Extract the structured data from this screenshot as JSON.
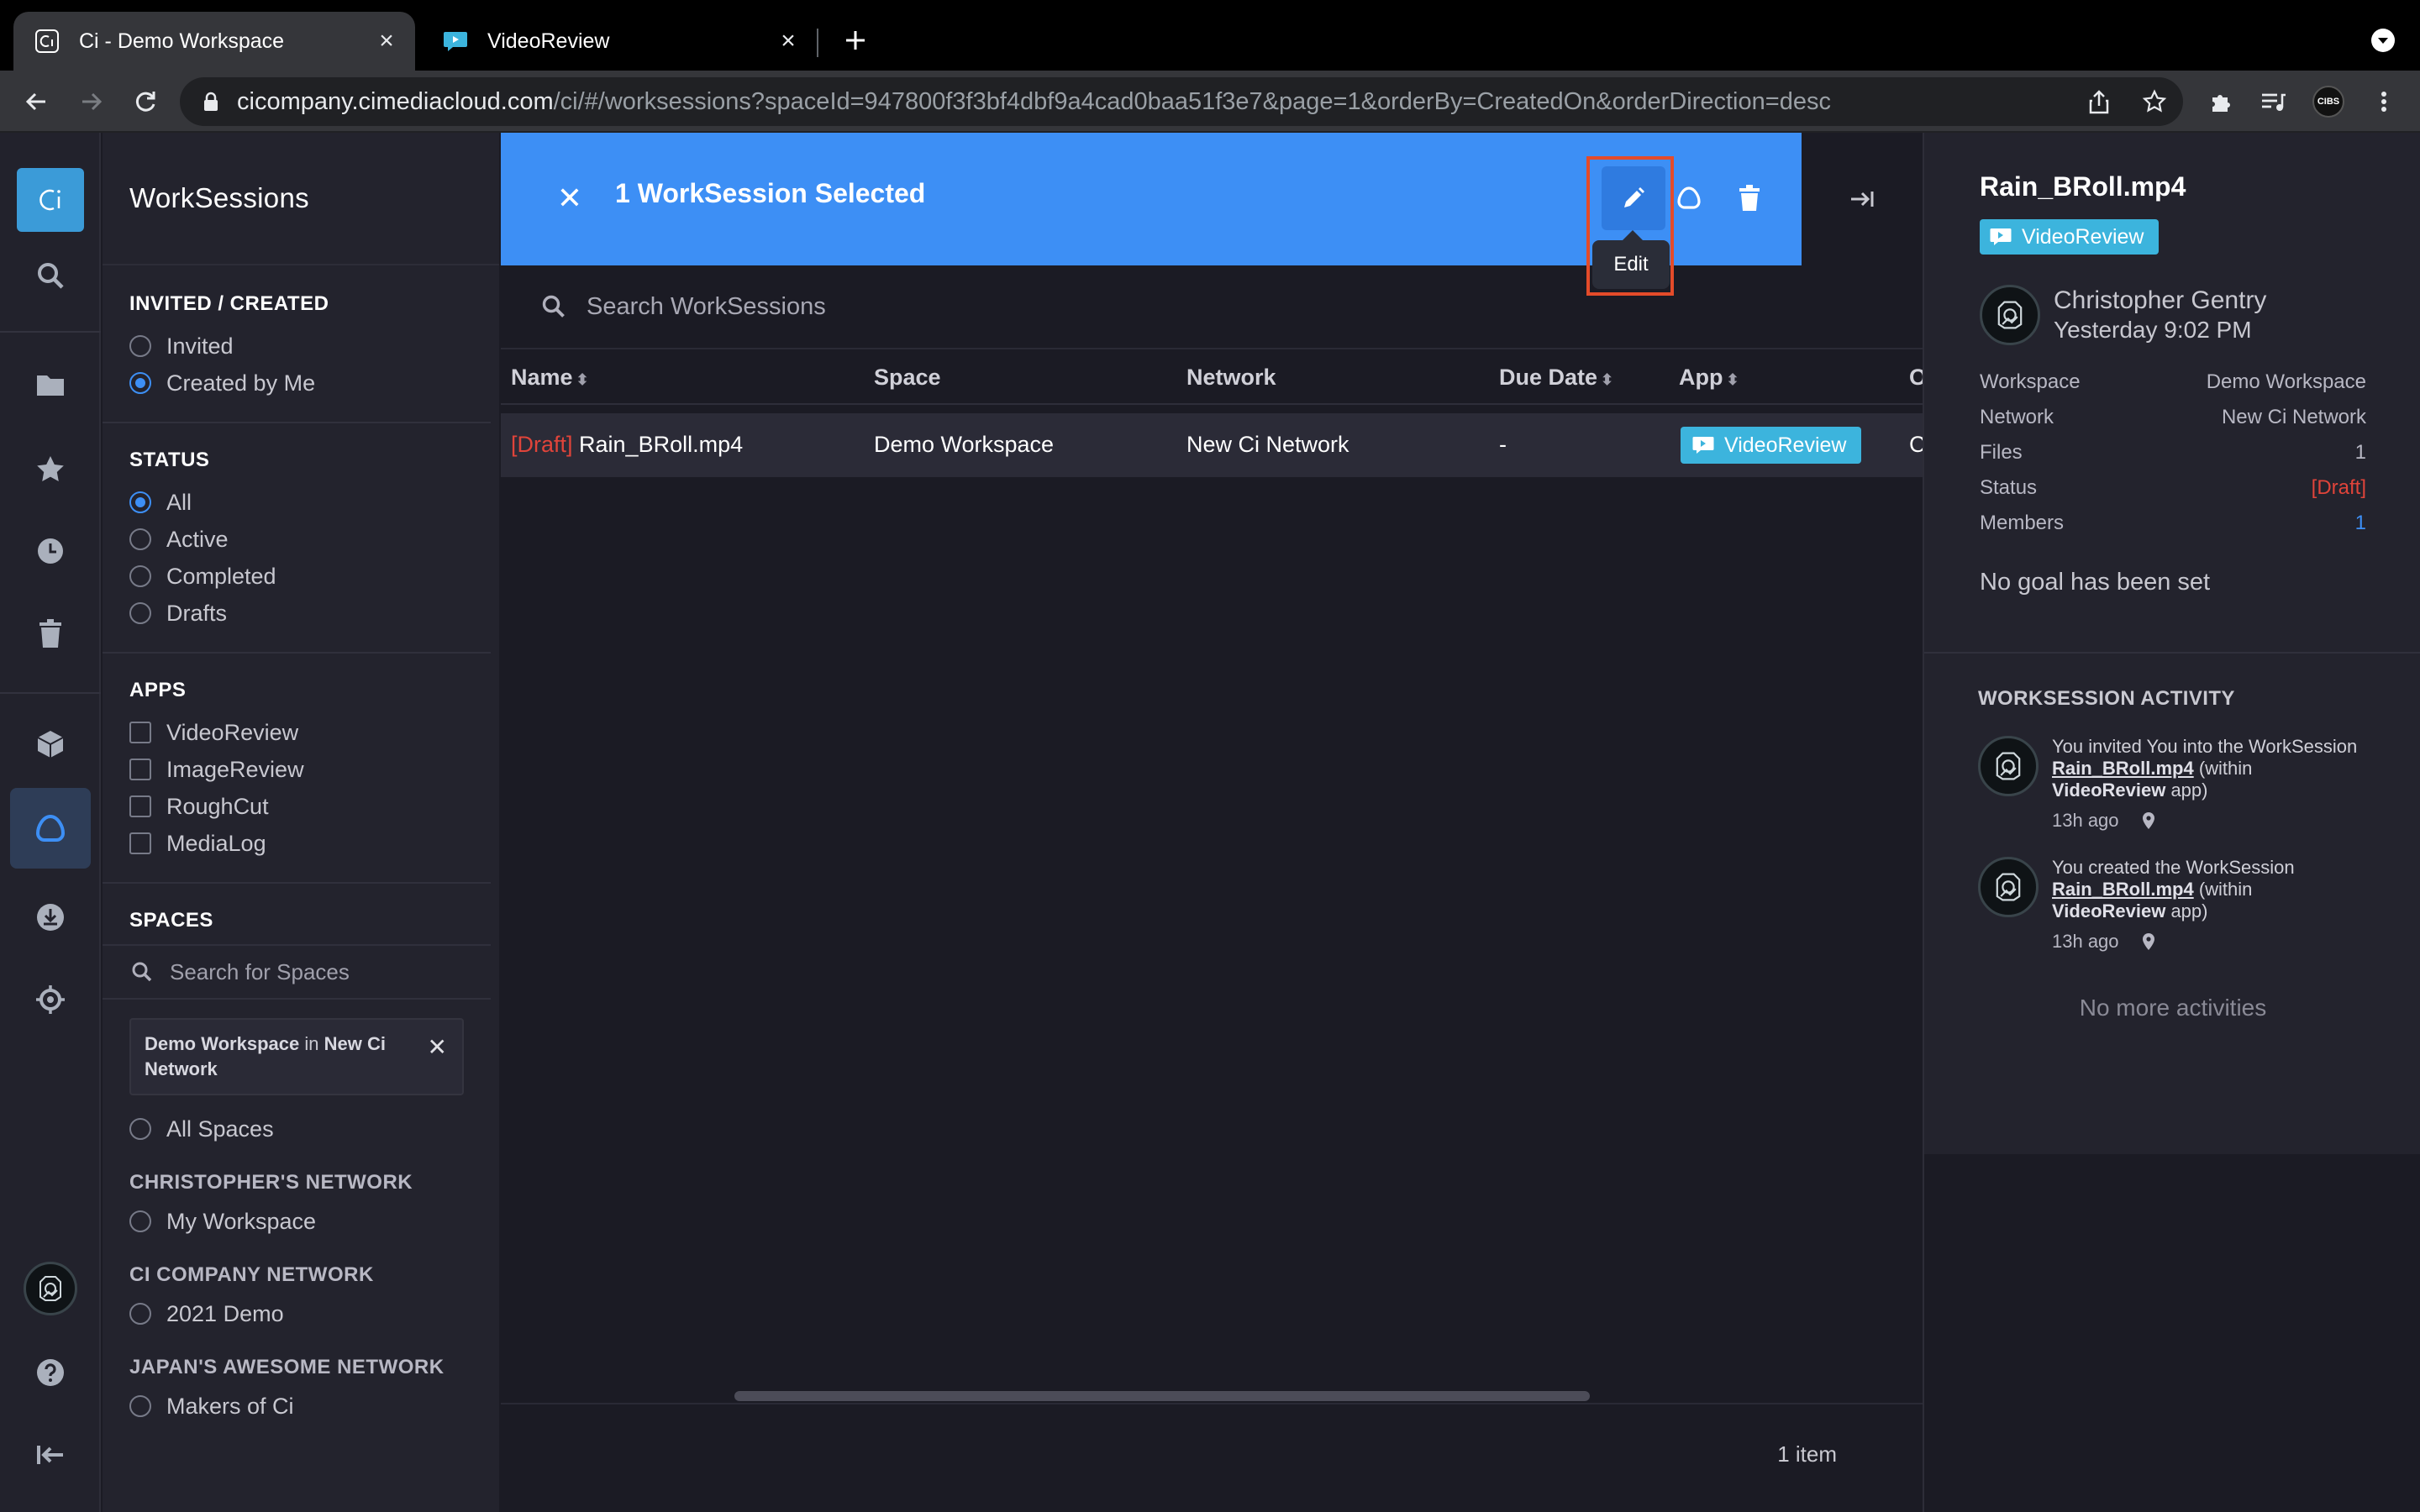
{
  "browser": {
    "tabs": [
      {
        "title": "Ci - Demo Workspace",
        "active": true
      },
      {
        "title": "VideoReview",
        "active": false
      }
    ],
    "url_host": "cicompany.cimediacloud.com",
    "url_path": "/ci/#/worksessions?spaceId=947800f3f3bf4dbf9a4cad0baa51f3e7&page=1&orderBy=CreatedOn&orderDirection=desc",
    "profile_label": "CIBS"
  },
  "rail": {
    "logo_text": "Ci",
    "items": [
      "search-icon",
      "folder-icon",
      "star-icon",
      "clock-icon",
      "trash-icon",
      "cube-icon",
      "worksession-icon",
      "download-icon",
      "target-icon"
    ],
    "bottom": [
      "avatar",
      "help-icon",
      "collapse-icon"
    ]
  },
  "filters": {
    "title": "WorkSessions",
    "invited_created": {
      "heading": "INVITED / CREATED",
      "options": [
        {
          "label": "Invited",
          "checked": false
        },
        {
          "label": "Created by Me",
          "checked": true
        }
      ]
    },
    "status": {
      "heading": "STATUS",
      "options": [
        {
          "label": "All",
          "checked": true
        },
        {
          "label": "Active",
          "checked": false
        },
        {
          "label": "Completed",
          "checked": false
        },
        {
          "label": "Drafts",
          "checked": false
        }
      ]
    },
    "apps": {
      "heading": "APPS",
      "options": [
        {
          "label": "VideoReview",
          "checked": false
        },
        {
          "label": "ImageReview",
          "checked": false
        },
        {
          "label": "RoughCut",
          "checked": false
        },
        {
          "label": "MediaLog",
          "checked": false
        }
      ]
    },
    "spaces": {
      "heading": "SPACES",
      "search_placeholder": "Search for Spaces",
      "chip": {
        "space": "Demo Workspace",
        "in": "in",
        "network": "New Ci Network"
      },
      "all_spaces": "All Spaces",
      "networks": [
        {
          "heading": "CHRISTOPHER'S NETWORK",
          "options": [
            "My Workspace"
          ]
        },
        {
          "heading": "CI COMPANY NETWORK",
          "options": [
            "2021 Demo"
          ]
        },
        {
          "heading": "JAPAN'S AWESOME NETWORK",
          "options": [
            "Makers of Ci"
          ]
        }
      ]
    }
  },
  "selection": {
    "title": "1 WorkSession Selected",
    "tooltip": "Edit"
  },
  "search": {
    "placeholder": "Search WorkSessions"
  },
  "table": {
    "columns": [
      "Name",
      "Space",
      "Network",
      "Due Date",
      "App",
      "O"
    ],
    "rows": [
      {
        "draft_tag": "[Draft]",
        "name": "Rain_BRoll.mp4",
        "space": "Demo Workspace",
        "network": "New Ci Network",
        "due": "-",
        "app": "VideoReview",
        "owner": "C"
      }
    ],
    "count": "1 item"
  },
  "detail": {
    "title": "Rain_BRoll.mp4",
    "app": "VideoReview",
    "owner_name": "Christopher Gentry",
    "owner_time": "Yesterday 9:02 PM",
    "props": [
      {
        "label": "Workspace",
        "value": "Demo Workspace"
      },
      {
        "label": "Network",
        "value": "New Ci Network"
      },
      {
        "label": "Files",
        "value": "1"
      },
      {
        "label": "Status",
        "value": "[Draft]"
      },
      {
        "label": "Members",
        "value": "1"
      }
    ],
    "goal": "No goal has been set",
    "activity_heading": "WORKSESSION ACTIVITY",
    "activities": [
      {
        "pre": "You invited You into the WorkSession ",
        "link": "Rain_BRoll.mp4",
        "mid": " (within ",
        "app": "VideoReview",
        "post": " app)",
        "time": "13h ago"
      },
      {
        "pre": "You created the WorkSession ",
        "link": "Rain_BRoll.mp4",
        "mid": " (within ",
        "app": "VideoReview",
        "post": " app)",
        "time": "13h ago"
      }
    ],
    "no_more": "No more activities"
  },
  "colors": {
    "accent": "#3d8ff5",
    "app_badge": "#3cb4dd",
    "draft": "#e0443a",
    "highlight": "#e44b2a"
  }
}
